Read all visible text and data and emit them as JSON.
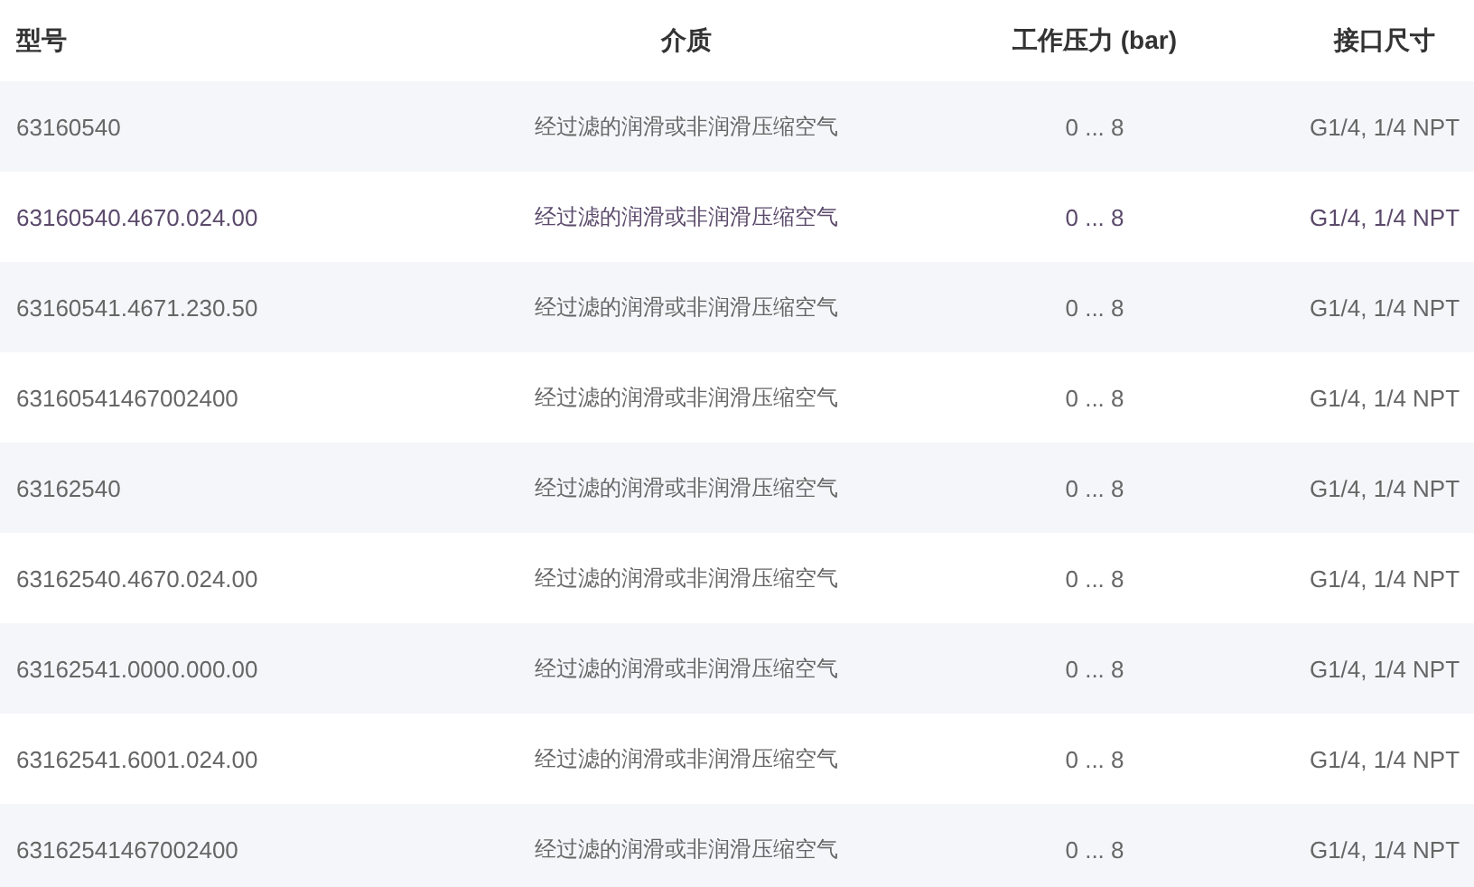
{
  "table": {
    "columns": [
      "型号",
      "介质",
      "工作压力 (bar)",
      "接口尺寸"
    ],
    "rows": [
      {
        "cells": [
          "63160540",
          "经过滤的润滑或非润滑压缩空气",
          "0 ... 8",
          "G1/4, 1/4 NPT"
        ],
        "highlighted": false
      },
      {
        "cells": [
          "63160540.4670.024.00",
          "经过滤的润滑或非润滑压缩空气",
          "0 ... 8",
          "G1/4, 1/4 NPT"
        ],
        "highlighted": true
      },
      {
        "cells": [
          "63160541.4671.230.50",
          "经过滤的润滑或非润滑压缩空气",
          "0 ... 8",
          "G1/4, 1/4 NPT"
        ],
        "highlighted": false
      },
      {
        "cells": [
          "63160541467002400",
          "经过滤的润滑或非润滑压缩空气",
          "0 ... 8",
          "G1/4, 1/4 NPT"
        ],
        "highlighted": false
      },
      {
        "cells": [
          "63162540",
          "经过滤的润滑或非润滑压缩空气",
          "0 ... 8",
          "G1/4, 1/4 NPT"
        ],
        "highlighted": false
      },
      {
        "cells": [
          "63162540.4670.024.00",
          "经过滤的润滑或非润滑压缩空气",
          "0 ... 8",
          "G1/4, 1/4 NPT"
        ],
        "highlighted": false
      },
      {
        "cells": [
          "63162541.0000.000.00",
          "经过滤的润滑或非润滑压缩空气",
          "0 ... 8",
          "G1/4, 1/4 NPT"
        ],
        "highlighted": false
      },
      {
        "cells": [
          "63162541.6001.024.00",
          "经过滤的润滑或非润滑压缩空气",
          "0 ... 8",
          "G1/4, 1/4 NPT"
        ],
        "highlighted": false
      },
      {
        "cells": [
          "63162541467002400",
          "经过滤的润滑或非润滑压缩空气",
          "0 ... 8",
          "G1/4, 1/4 NPT"
        ],
        "highlighted": false
      }
    ]
  }
}
